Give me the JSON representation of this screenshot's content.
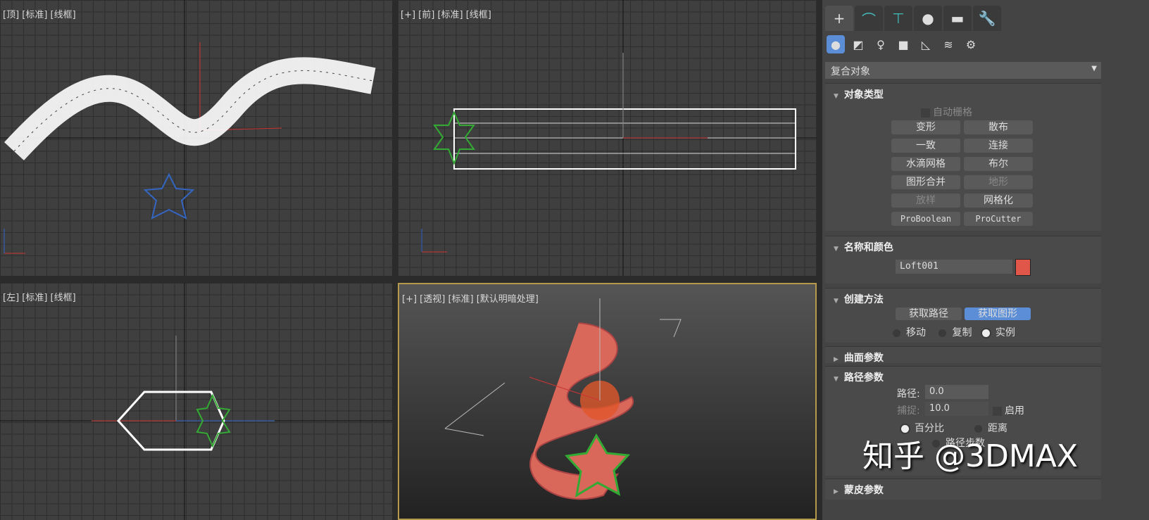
{
  "viewports": {
    "top": "[顶] [标准] [线框]",
    "front": "[+] [前] [标准] [线框]",
    "left": "[左] [标准] [线框]",
    "perspective": "[+] [透视] [标准] [默认明暗处理]"
  },
  "panel": {
    "tabs": [
      "create",
      "modify",
      "hierarchy",
      "motion",
      "display",
      "utilities"
    ],
    "category": "复合对象",
    "object_type": {
      "title": "对象类型",
      "autogrid": "自动栅格",
      "buttons": [
        "变形",
        "散布",
        "一致",
        "连接",
        "水滴网格",
        "布尔",
        "图形合并",
        "地形",
        "放样",
        "网格化",
        "ProBoolean",
        "ProCutter"
      ]
    },
    "name_color": {
      "title": "名称和颜色",
      "name": "Loft001",
      "color": "#e0574a"
    },
    "creation": {
      "title": "创建方法",
      "get_path": "获取路径",
      "get_shape": "获取图形",
      "move": "移动",
      "copy": "复制",
      "instance": "实例"
    },
    "surface": {
      "title": "曲面参数"
    },
    "path_params": {
      "title": "路径参数",
      "path_label": "路径:",
      "path_value": "0.0",
      "snap_label": "捕捉:",
      "snap_value": "10.0",
      "enable": "启用",
      "percent": "百分比",
      "distance": "距离",
      "path_steps": "路径步数"
    },
    "skin": {
      "title": "蒙皮参数"
    }
  },
  "watermark": "知乎 @3DMAX"
}
